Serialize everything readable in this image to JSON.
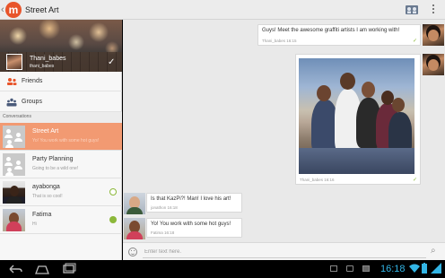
{
  "actionbar": {
    "logo_letter": "m",
    "title": "Street Art"
  },
  "profile": {
    "name": "Thani_babes",
    "status": "thani_babes"
  },
  "nav": [
    {
      "label": "Friends"
    },
    {
      "label": "Groups"
    }
  ],
  "conversations_header": "Conversations",
  "conversations": [
    {
      "name": "Street Art",
      "preview": "Yo! You work with some hot guys!",
      "active": true,
      "online": ""
    },
    {
      "name": "Party Planning",
      "preview": "Going to be a wild one!",
      "active": false,
      "online": ""
    },
    {
      "name": "ayabonga",
      "preview": "That is so cool!",
      "active": false,
      "online": "away"
    },
    {
      "name": "Fatima",
      "preview": "Hi",
      "active": false,
      "online": "online"
    }
  ],
  "messages": [
    {
      "text": "Guys! Meet the awesome graffiti artists I am working with!",
      "author": "Thani_babes",
      "time": "16:15",
      "outgoing": true
    },
    {
      "text": "",
      "author": "Thani_babes",
      "time": "16:16",
      "outgoing": true,
      "photo": true
    },
    {
      "text": "Is that KazPi?! Man! I love his art!",
      "author": "jonathon",
      "time": "16:18",
      "outgoing": false
    },
    {
      "text": "Yo! You work with some hot guys!",
      "author": "Fatima",
      "time": "16:18",
      "outgoing": false
    }
  ],
  "input": {
    "placeholder": "Enter text here."
  },
  "systembar": {
    "clock": "16:18"
  },
  "colors": {
    "accent": "#e8542a",
    "active_row": "#f29a72",
    "online": "#8cb83a",
    "clock": "#33b5e5"
  }
}
